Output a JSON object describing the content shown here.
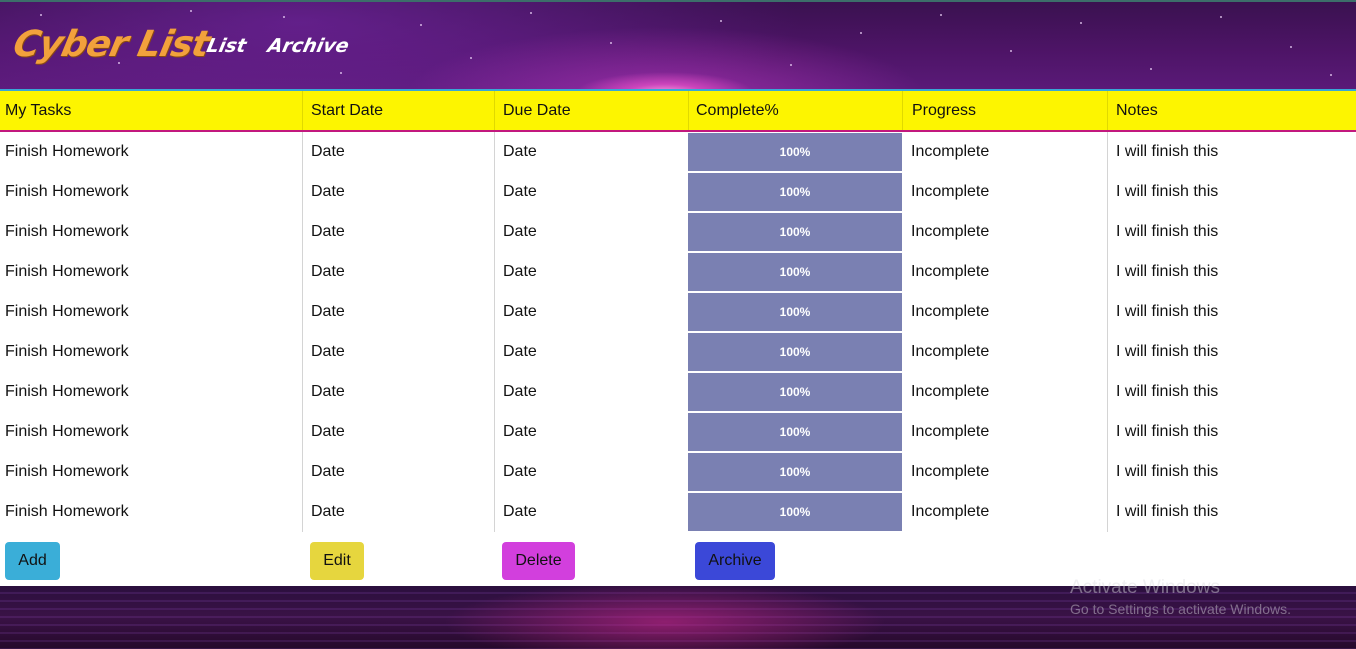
{
  "header": {
    "logo": "Cyber List",
    "nav": {
      "list": "List",
      "archive": "Archive"
    }
  },
  "table": {
    "columns": [
      "My Tasks",
      "Start Date",
      "Due Date",
      "Complete%",
      "Progress",
      "Notes"
    ],
    "rows": [
      {
        "task": "Finish Homework",
        "start": "Date",
        "due": "Date",
        "complete": "100%",
        "progress": "Incomplete",
        "notes": "I will finish this"
      },
      {
        "task": "Finish Homework",
        "start": "Date",
        "due": "Date",
        "complete": "100%",
        "progress": "Incomplete",
        "notes": "I will finish this"
      },
      {
        "task": "Finish Homework",
        "start": "Date",
        "due": "Date",
        "complete": "100%",
        "progress": "Incomplete",
        "notes": "I will finish this"
      },
      {
        "task": "Finish Homework",
        "start": "Date",
        "due": "Date",
        "complete": "100%",
        "progress": "Incomplete",
        "notes": "I will finish this"
      },
      {
        "task": "Finish Homework",
        "start": "Date",
        "due": "Date",
        "complete": "100%",
        "progress": "Incomplete",
        "notes": "I will finish this"
      },
      {
        "task": "Finish Homework",
        "start": "Date",
        "due": "Date",
        "complete": "100%",
        "progress": "Incomplete",
        "notes": "I will finish this"
      },
      {
        "task": "Finish Homework",
        "start": "Date",
        "due": "Date",
        "complete": "100%",
        "progress": "Incomplete",
        "notes": "I will finish this"
      },
      {
        "task": "Finish Homework",
        "start": "Date",
        "due": "Date",
        "complete": "100%",
        "progress": "Incomplete",
        "notes": "I will finish this"
      },
      {
        "task": "Finish Homework",
        "start": "Date",
        "due": "Date",
        "complete": "100%",
        "progress": "Incomplete",
        "notes": "I will finish this"
      },
      {
        "task": "Finish Homework",
        "start": "Date",
        "due": "Date",
        "complete": "100%",
        "progress": "Incomplete",
        "notes": "I will finish this"
      }
    ]
  },
  "buttons": {
    "add": "Add",
    "edit": "Edit",
    "delete": "Delete",
    "archive": "Archive"
  },
  "watermark": {
    "title": "Activate Windows",
    "subtitle": "Go to Settings to activate Windows."
  },
  "colors": {
    "header_bar": "#fdf500",
    "complete_cell": "#7a80b2",
    "add": "#3aaed8",
    "edit": "#e6d63e",
    "delete": "#d23fdd",
    "archive": "#3b48d8",
    "logo": "#f2a13c"
  }
}
